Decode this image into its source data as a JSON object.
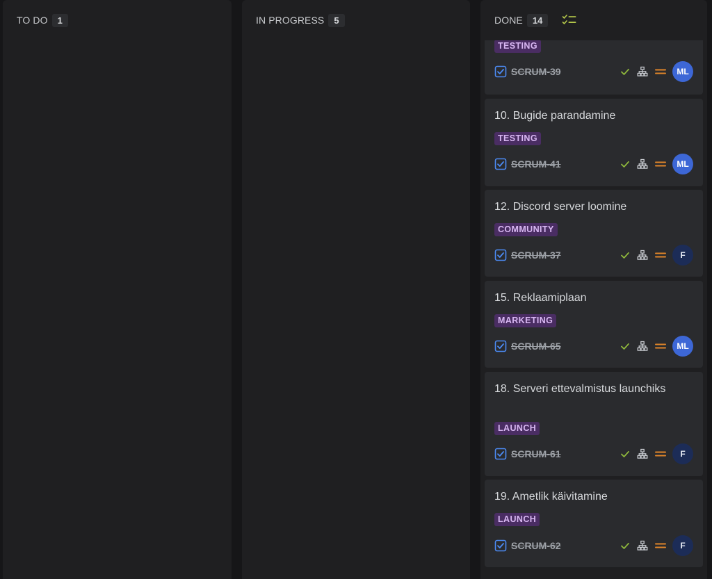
{
  "columns": {
    "todo": {
      "title": "TO DO",
      "count": "1"
    },
    "in_progress": {
      "title": "IN PROGRESS",
      "count": "5"
    },
    "done": {
      "title": "DONE",
      "count": "14"
    }
  },
  "colors": {
    "label_bg": "#4a2d63",
    "label_text": "#d8b7f2",
    "check_green": "#8fb83c",
    "priority_orange": "#e0862a",
    "avatar_ml": "#3d67d6",
    "avatar_f": "#1c2c57",
    "type_icon_blue": "#4c8bf5"
  },
  "done_cards": [
    {
      "title": "",
      "label": "TESTING",
      "key": "SCRUM-39",
      "avatar": "ML",
      "partial": true
    },
    {
      "title": "10. Bugide parandamine",
      "label": "TESTING",
      "key": "SCRUM-41",
      "avatar": "ML"
    },
    {
      "title": "12. Discord server loomine",
      "label": "COMMUNITY",
      "key": "SCRUM-37",
      "avatar": "F"
    },
    {
      "title": "15. Reklaamiplaan",
      "label": "MARKETING",
      "key": "SCRUM-65",
      "avatar": "ML"
    },
    {
      "title": "18. Serveri ettevalmistus launchiks",
      "label": "LAUNCH",
      "key": "SCRUM-61",
      "avatar": "F"
    },
    {
      "title": "19. Ametlik käivitamine",
      "label": "LAUNCH",
      "key": "SCRUM-62",
      "avatar": "F"
    }
  ],
  "icons": {
    "type": "checkbox-task-icon",
    "done_status": "checkmark-icon",
    "hierarchy": "subtask-hierarchy-icon",
    "priority": "priority-medium-icon",
    "column_done": "done-checklist-icon"
  }
}
